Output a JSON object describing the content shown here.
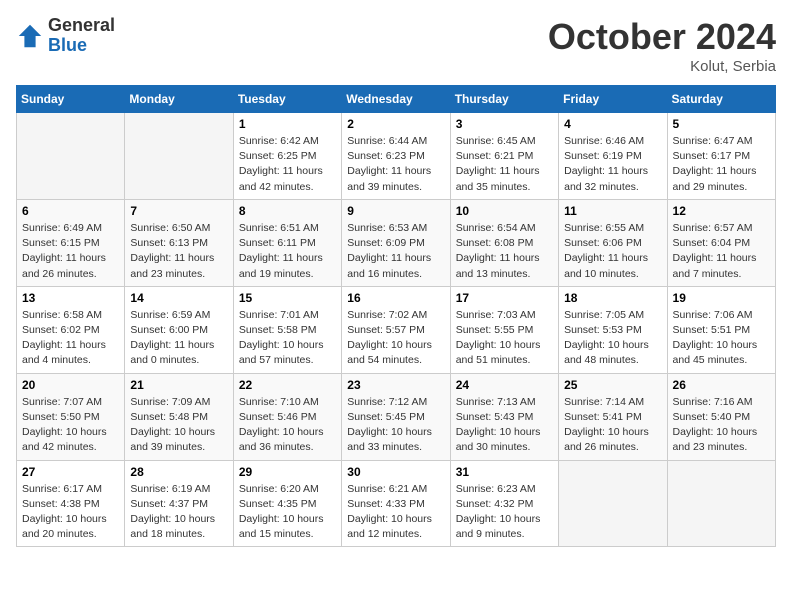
{
  "logo": {
    "general": "General",
    "blue": "Blue"
  },
  "header": {
    "month": "October 2024",
    "location": "Kolut, Serbia"
  },
  "weekdays": [
    "Sunday",
    "Monday",
    "Tuesday",
    "Wednesday",
    "Thursday",
    "Friday",
    "Saturday"
  ],
  "weeks": [
    [
      {
        "day": "",
        "info": ""
      },
      {
        "day": "",
        "info": ""
      },
      {
        "day": "1",
        "sunrise": "Sunrise: 6:42 AM",
        "sunset": "Sunset: 6:25 PM",
        "daylight": "Daylight: 11 hours and 42 minutes."
      },
      {
        "day": "2",
        "sunrise": "Sunrise: 6:44 AM",
        "sunset": "Sunset: 6:23 PM",
        "daylight": "Daylight: 11 hours and 39 minutes."
      },
      {
        "day": "3",
        "sunrise": "Sunrise: 6:45 AM",
        "sunset": "Sunset: 6:21 PM",
        "daylight": "Daylight: 11 hours and 35 minutes."
      },
      {
        "day": "4",
        "sunrise": "Sunrise: 6:46 AM",
        "sunset": "Sunset: 6:19 PM",
        "daylight": "Daylight: 11 hours and 32 minutes."
      },
      {
        "day": "5",
        "sunrise": "Sunrise: 6:47 AM",
        "sunset": "Sunset: 6:17 PM",
        "daylight": "Daylight: 11 hours and 29 minutes."
      }
    ],
    [
      {
        "day": "6",
        "sunrise": "Sunrise: 6:49 AM",
        "sunset": "Sunset: 6:15 PM",
        "daylight": "Daylight: 11 hours and 26 minutes."
      },
      {
        "day": "7",
        "sunrise": "Sunrise: 6:50 AM",
        "sunset": "Sunset: 6:13 PM",
        "daylight": "Daylight: 11 hours and 23 minutes."
      },
      {
        "day": "8",
        "sunrise": "Sunrise: 6:51 AM",
        "sunset": "Sunset: 6:11 PM",
        "daylight": "Daylight: 11 hours and 19 minutes."
      },
      {
        "day": "9",
        "sunrise": "Sunrise: 6:53 AM",
        "sunset": "Sunset: 6:09 PM",
        "daylight": "Daylight: 11 hours and 16 minutes."
      },
      {
        "day": "10",
        "sunrise": "Sunrise: 6:54 AM",
        "sunset": "Sunset: 6:08 PM",
        "daylight": "Daylight: 11 hours and 13 minutes."
      },
      {
        "day": "11",
        "sunrise": "Sunrise: 6:55 AM",
        "sunset": "Sunset: 6:06 PM",
        "daylight": "Daylight: 11 hours and 10 minutes."
      },
      {
        "day": "12",
        "sunrise": "Sunrise: 6:57 AM",
        "sunset": "Sunset: 6:04 PM",
        "daylight": "Daylight: 11 hours and 7 minutes."
      }
    ],
    [
      {
        "day": "13",
        "sunrise": "Sunrise: 6:58 AM",
        "sunset": "Sunset: 6:02 PM",
        "daylight": "Daylight: 11 hours and 4 minutes."
      },
      {
        "day": "14",
        "sunrise": "Sunrise: 6:59 AM",
        "sunset": "Sunset: 6:00 PM",
        "daylight": "Daylight: 11 hours and 0 minutes."
      },
      {
        "day": "15",
        "sunrise": "Sunrise: 7:01 AM",
        "sunset": "Sunset: 5:58 PM",
        "daylight": "Daylight: 10 hours and 57 minutes."
      },
      {
        "day": "16",
        "sunrise": "Sunrise: 7:02 AM",
        "sunset": "Sunset: 5:57 PM",
        "daylight": "Daylight: 10 hours and 54 minutes."
      },
      {
        "day": "17",
        "sunrise": "Sunrise: 7:03 AM",
        "sunset": "Sunset: 5:55 PM",
        "daylight": "Daylight: 10 hours and 51 minutes."
      },
      {
        "day": "18",
        "sunrise": "Sunrise: 7:05 AM",
        "sunset": "Sunset: 5:53 PM",
        "daylight": "Daylight: 10 hours and 48 minutes."
      },
      {
        "day": "19",
        "sunrise": "Sunrise: 7:06 AM",
        "sunset": "Sunset: 5:51 PM",
        "daylight": "Daylight: 10 hours and 45 minutes."
      }
    ],
    [
      {
        "day": "20",
        "sunrise": "Sunrise: 7:07 AM",
        "sunset": "Sunset: 5:50 PM",
        "daylight": "Daylight: 10 hours and 42 minutes."
      },
      {
        "day": "21",
        "sunrise": "Sunrise: 7:09 AM",
        "sunset": "Sunset: 5:48 PM",
        "daylight": "Daylight: 10 hours and 39 minutes."
      },
      {
        "day": "22",
        "sunrise": "Sunrise: 7:10 AM",
        "sunset": "Sunset: 5:46 PM",
        "daylight": "Daylight: 10 hours and 36 minutes."
      },
      {
        "day": "23",
        "sunrise": "Sunrise: 7:12 AM",
        "sunset": "Sunset: 5:45 PM",
        "daylight": "Daylight: 10 hours and 33 minutes."
      },
      {
        "day": "24",
        "sunrise": "Sunrise: 7:13 AM",
        "sunset": "Sunset: 5:43 PM",
        "daylight": "Daylight: 10 hours and 30 minutes."
      },
      {
        "day": "25",
        "sunrise": "Sunrise: 7:14 AM",
        "sunset": "Sunset: 5:41 PM",
        "daylight": "Daylight: 10 hours and 26 minutes."
      },
      {
        "day": "26",
        "sunrise": "Sunrise: 7:16 AM",
        "sunset": "Sunset: 5:40 PM",
        "daylight": "Daylight: 10 hours and 23 minutes."
      }
    ],
    [
      {
        "day": "27",
        "sunrise": "Sunrise: 6:17 AM",
        "sunset": "Sunset: 4:38 PM",
        "daylight": "Daylight: 10 hours and 20 minutes."
      },
      {
        "day": "28",
        "sunrise": "Sunrise: 6:19 AM",
        "sunset": "Sunset: 4:37 PM",
        "daylight": "Daylight: 10 hours and 18 minutes."
      },
      {
        "day": "29",
        "sunrise": "Sunrise: 6:20 AM",
        "sunset": "Sunset: 4:35 PM",
        "daylight": "Daylight: 10 hours and 15 minutes."
      },
      {
        "day": "30",
        "sunrise": "Sunrise: 6:21 AM",
        "sunset": "Sunset: 4:33 PM",
        "daylight": "Daylight: 10 hours and 12 minutes."
      },
      {
        "day": "31",
        "sunrise": "Sunrise: 6:23 AM",
        "sunset": "Sunset: 4:32 PM",
        "daylight": "Daylight: 10 hours and 9 minutes."
      },
      {
        "day": "",
        "info": ""
      },
      {
        "day": "",
        "info": ""
      }
    ]
  ]
}
